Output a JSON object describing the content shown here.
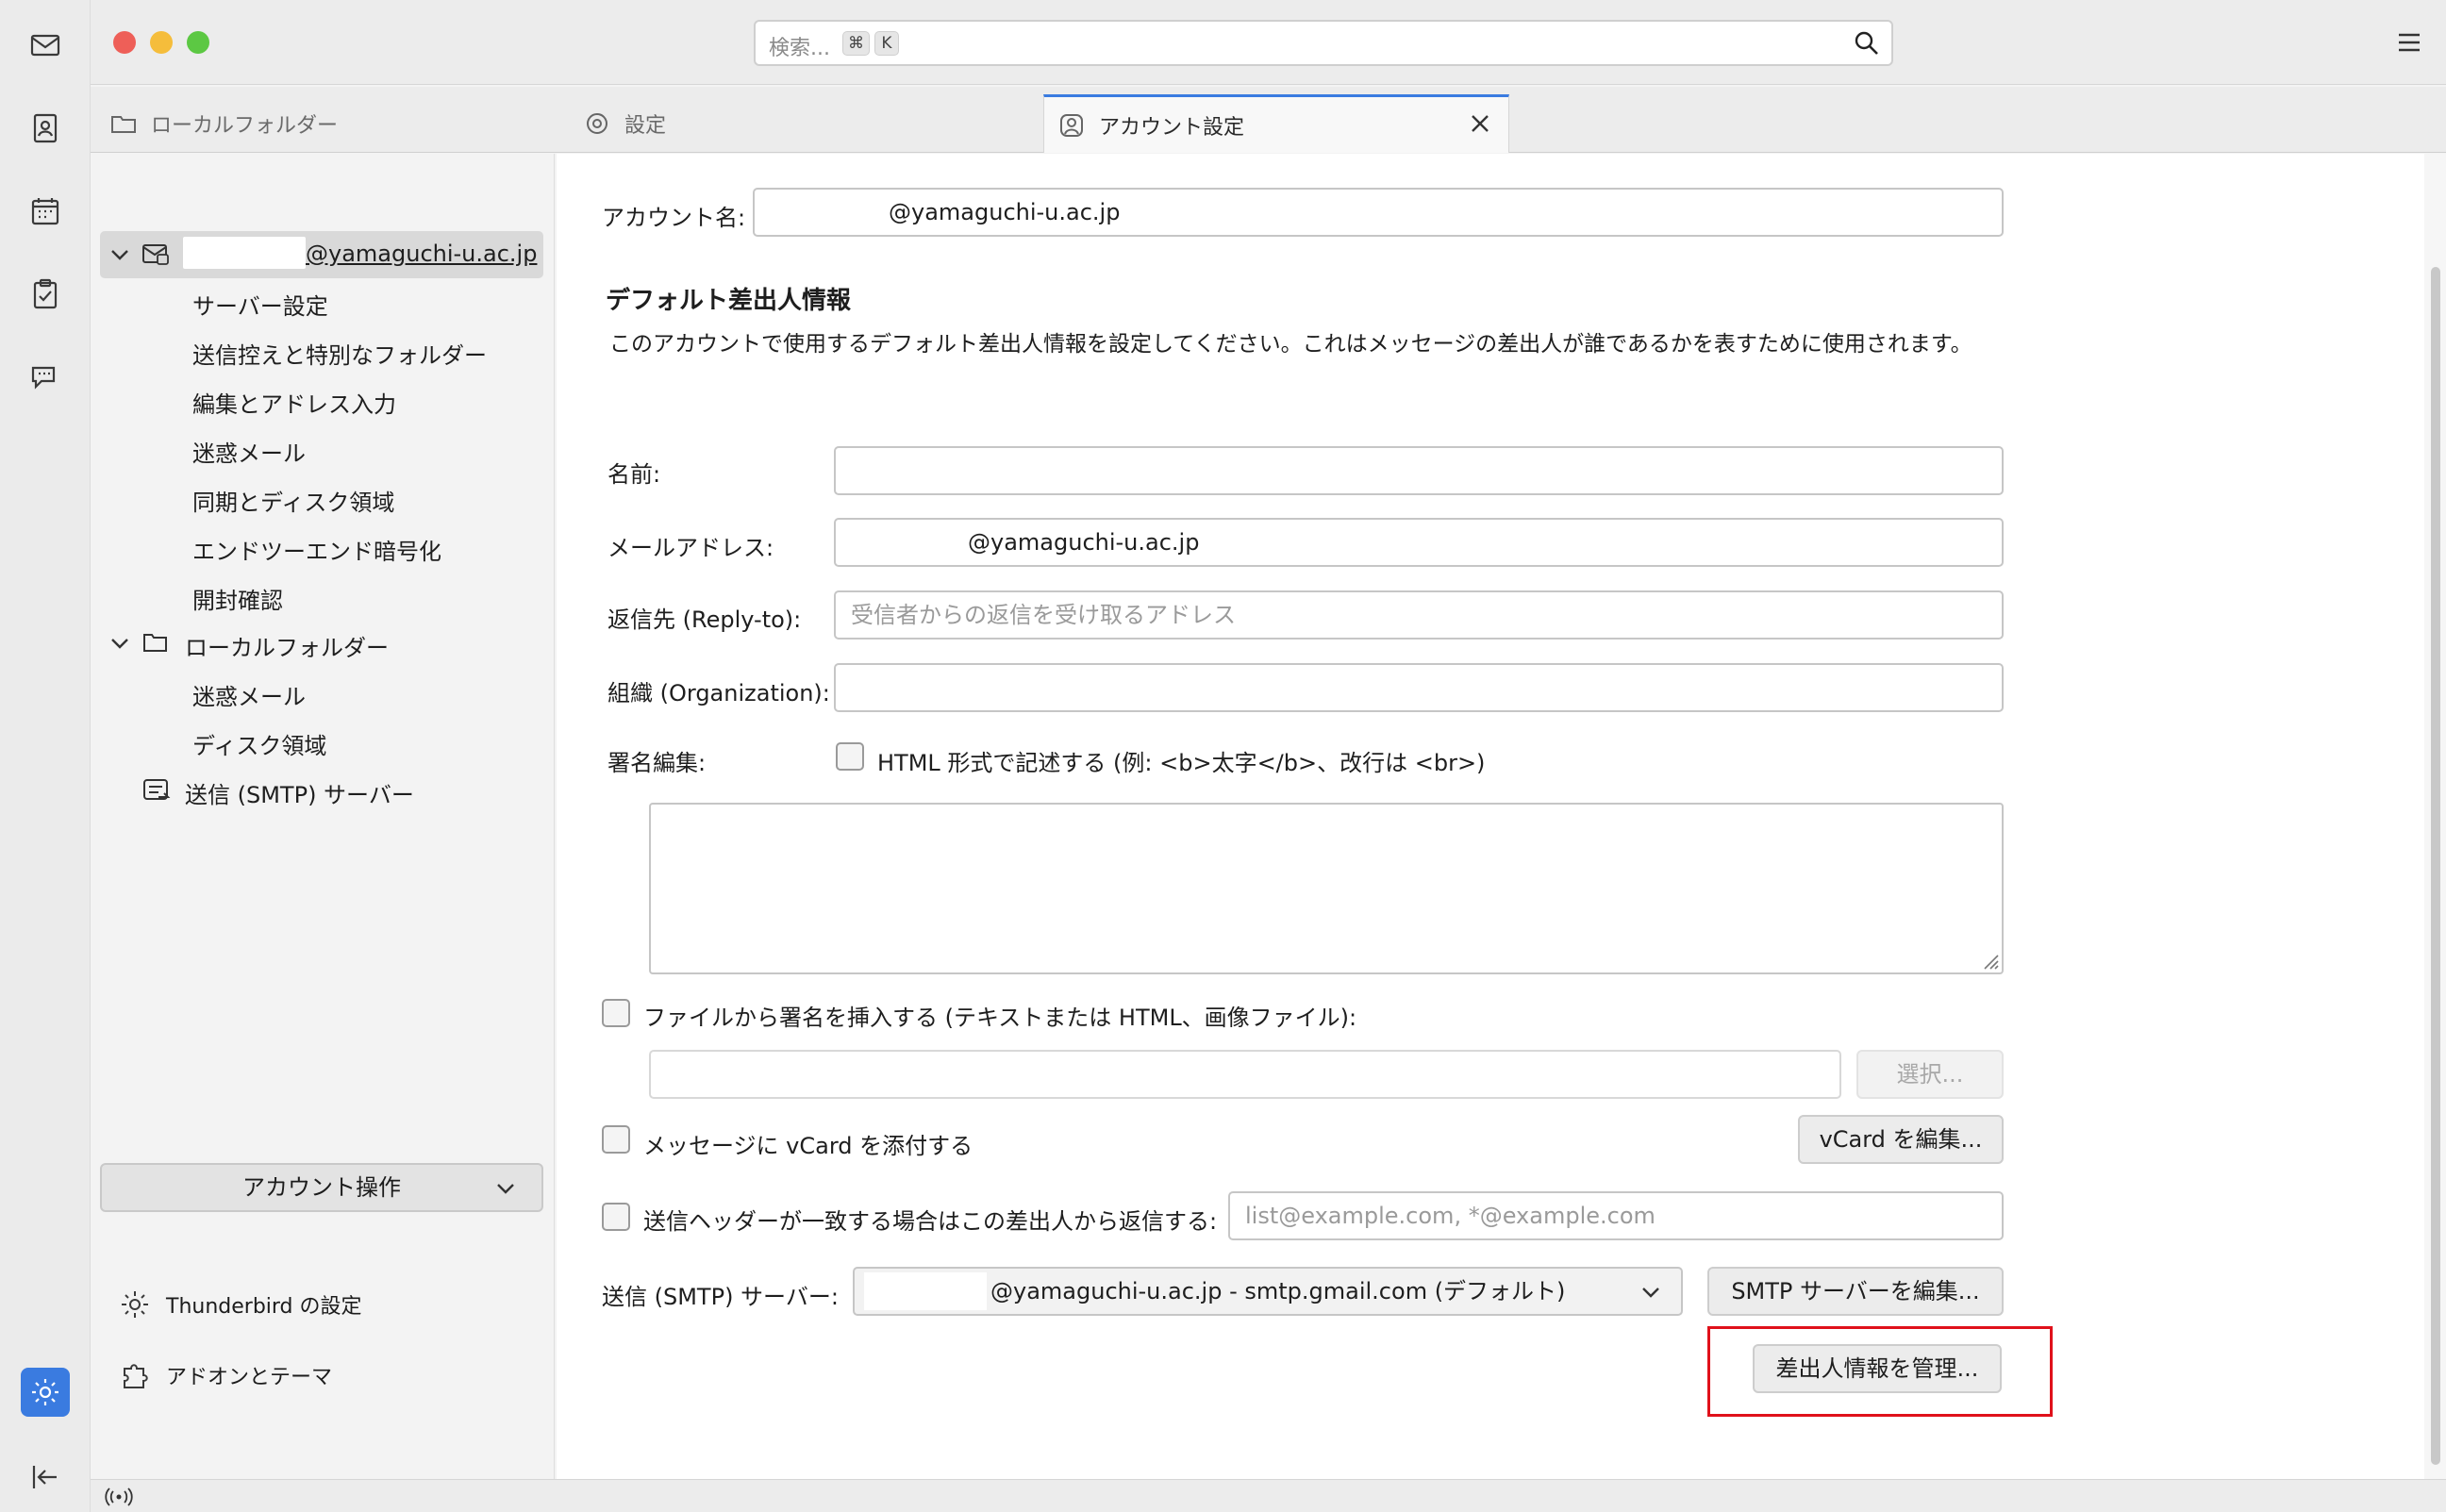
{
  "window": {
    "search": {
      "placeholder": "検索...",
      "kbd1": "⌘",
      "kbd2": "K"
    }
  },
  "tabs": [
    {
      "label": "ローカルフォルダー"
    },
    {
      "label": "設定"
    },
    {
      "label": "アカウント設定"
    }
  ],
  "tree": {
    "account": "@yamaguchi-u.ac.jp",
    "account_items": [
      "サーバー設定",
      "送信控えと特別なフォルダー",
      "編集とアドレス入力",
      "迷惑メール",
      "同期とディスク領域",
      "エンドツーエンド暗号化",
      "開封確認"
    ],
    "local_folders": "ローカルフォルダー",
    "local_items": [
      "迷惑メール",
      "ディスク領域"
    ],
    "smtp": "送信 (SMTP) サーバー",
    "account_ops": "アカウント操作",
    "footer": {
      "settings": "Thunderbird の設定",
      "addons": "アドオンとテーマ"
    }
  },
  "form": {
    "account_name_label": "アカウント名:",
    "account_name_value": "@yamaguchi-u.ac.jp",
    "section_title": "デフォルト差出人情報",
    "section_desc": "このアカウントで使用するデフォルト差出人情報を設定してください。これはメッセージの差出人が誰であるかを表すために使用されます。",
    "name_label": "名前:",
    "name_value": "",
    "email_label": "メールアドレス:",
    "email_value": "@yamaguchi-u.ac.jp",
    "replyto_label": "返信先 (Reply-to):",
    "replyto_placeholder": "受信者からの返信を受け取るアドレス",
    "org_label": "組織 (Organization):",
    "org_value": "",
    "sig_label": "署名編集:",
    "html_checkbox_label": "HTML 形式で記述する (例: <b>太字</b>、改行は <br>)",
    "file_sig_label": "ファイルから署名を挿入する (テキストまたは HTML、画像ファイル):",
    "choose_button": "選択...",
    "vcard_label": "メッセージに vCard を添付する",
    "vcard_button": "vCard を編集...",
    "reply_header_label": "送信ヘッダーが一致する場合はこの差出人から返信する:",
    "reply_header_placeholder": "list@example.com, *@example.com",
    "smtp_label": "送信 (SMTP) サーバー:",
    "smtp_value": "@yamaguchi-u.ac.jp - smtp.gmail.com (デフォルト)",
    "smtp_button": "SMTP サーバーを編集...",
    "identities_button": "差出人情報を管理..."
  },
  "colors": {
    "accent": "#3a7be0",
    "highlight": "#e0111b"
  }
}
